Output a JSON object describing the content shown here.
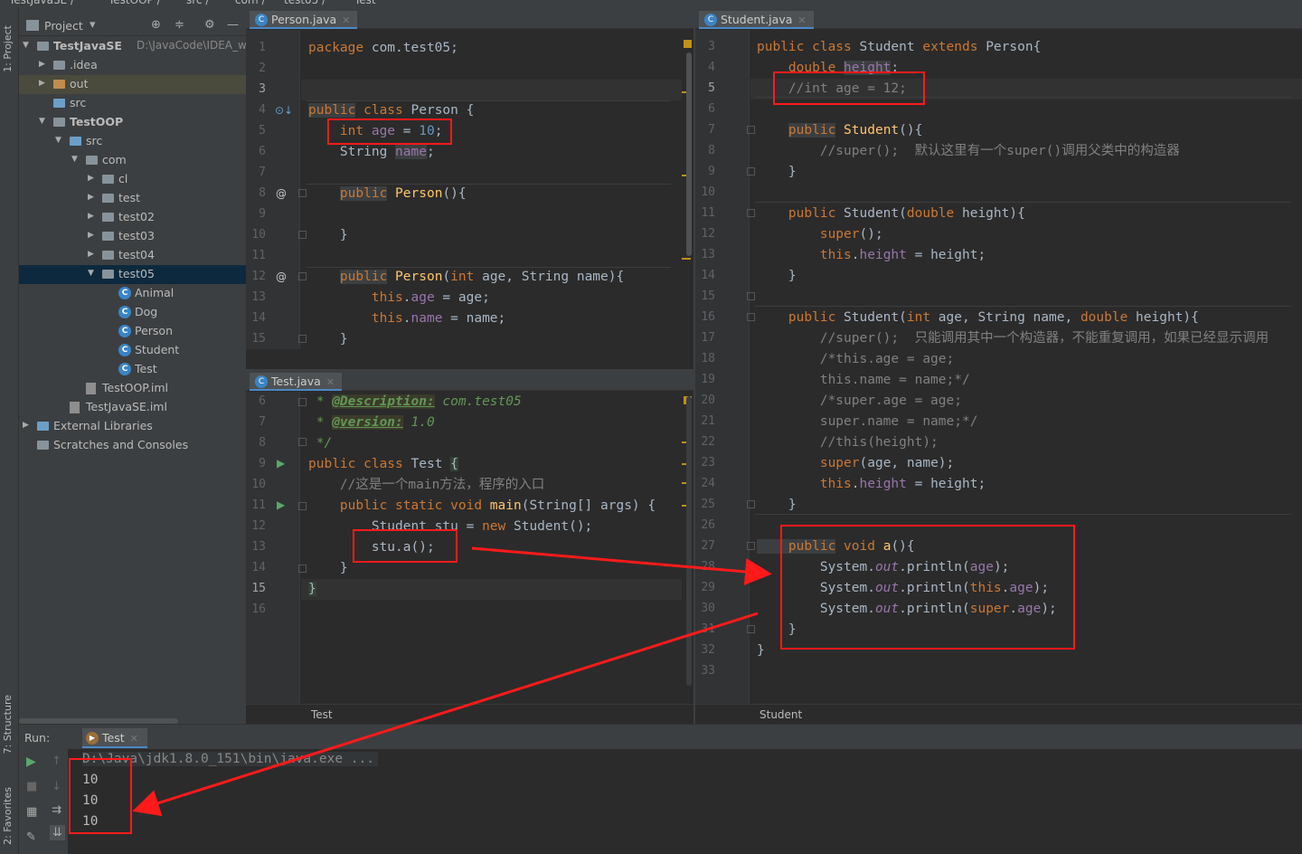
{
  "breadcrumb": [
    "TestJavaSE",
    "TestOOP",
    "src",
    "com",
    "test05",
    "Test"
  ],
  "side_tabs": {
    "project": "1: Project",
    "structure": "7: Structure",
    "favorites": "2: Favorites"
  },
  "project_panel": {
    "title": "Project",
    "tree": [
      {
        "label": "TestJavaSE",
        "extra": "D:\\JavaCode\\IDEA_work",
        "depth": 0,
        "arrow": "▼",
        "icon": "module",
        "bold": true
      },
      {
        "label": ".idea",
        "depth": 1,
        "arrow": "▶",
        "icon": "folder"
      },
      {
        "label": "out",
        "depth": 1,
        "arrow": "▶",
        "icon": "folder-orange",
        "hl": true
      },
      {
        "label": "src",
        "depth": 1,
        "arrow": "",
        "icon": "folder-blue"
      },
      {
        "label": "TestOOP",
        "depth": 1,
        "arrow": "▼",
        "icon": "module",
        "bold": true
      },
      {
        "label": "src",
        "depth": 2,
        "arrow": "▼",
        "icon": "folder-blue"
      },
      {
        "label": "com",
        "depth": 3,
        "arrow": "▼",
        "icon": "folder"
      },
      {
        "label": "cl",
        "depth": 4,
        "arrow": "▶",
        "icon": "folder"
      },
      {
        "label": "test",
        "depth": 4,
        "arrow": "▶",
        "icon": "folder"
      },
      {
        "label": "test02",
        "depth": 4,
        "arrow": "▶",
        "icon": "folder"
      },
      {
        "label": "test03",
        "depth": 4,
        "arrow": "▶",
        "icon": "folder"
      },
      {
        "label": "test04",
        "depth": 4,
        "arrow": "▶",
        "icon": "folder"
      },
      {
        "label": "test05",
        "depth": 4,
        "arrow": "▼",
        "icon": "folder",
        "selected": true
      },
      {
        "label": "Animal",
        "depth": 5,
        "arrow": "",
        "icon": "class"
      },
      {
        "label": "Dog",
        "depth": 5,
        "arrow": "",
        "icon": "class"
      },
      {
        "label": "Person",
        "depth": 5,
        "arrow": "",
        "icon": "class"
      },
      {
        "label": "Student",
        "depth": 5,
        "arrow": "",
        "icon": "class"
      },
      {
        "label": "Test",
        "depth": 5,
        "arrow": "",
        "icon": "class"
      },
      {
        "label": "TestOOP.iml",
        "depth": 3,
        "arrow": "",
        "icon": "iml"
      },
      {
        "label": "TestJavaSE.iml",
        "depth": 2,
        "arrow": "",
        "icon": "iml"
      },
      {
        "label": "External Libraries",
        "depth": 0,
        "arrow": "▶",
        "icon": "libs"
      },
      {
        "label": "Scratches and Consoles",
        "depth": 0,
        "arrow": "",
        "icon": "scratch"
      }
    ]
  },
  "person_editor": {
    "tab": "Person.java",
    "lines": [
      {
        "n": "1",
        "code": [
          [
            "kw",
            "package "
          ],
          [
            "",
            "com.test05;"
          ]
        ]
      },
      {
        "n": "2",
        "code": []
      },
      {
        "n": "3",
        "code": [],
        "cur": true
      },
      {
        "n": "4",
        "code": [
          [
            "kw unused",
            "public"
          ],
          [
            "kw",
            " class "
          ],
          [
            "",
            "Person {"
          ]
        ]
      },
      {
        "n": "5",
        "code": [
          [
            "",
            "    "
          ],
          [
            "kw",
            "int "
          ],
          [
            "fl",
            "age"
          ],
          [
            "",
            " = "
          ],
          [
            "num",
            "10"
          ],
          [
            "",
            ";"
          ]
        ]
      },
      {
        "n": "6",
        "code": [
          [
            "",
            "    String "
          ],
          [
            "fl unused",
            "name"
          ],
          [
            "",
            ";"
          ]
        ]
      },
      {
        "n": "7",
        "code": []
      },
      {
        "n": "8",
        "code": [
          [
            "",
            "    "
          ],
          [
            "kw unused",
            "public"
          ],
          [
            "",
            " "
          ],
          [
            "me",
            "Person"
          ],
          [
            "",
            "(){"
          ]
        ]
      },
      {
        "n": "9",
        "code": []
      },
      {
        "n": "10",
        "code": [
          [
            "",
            "    }"
          ]
        ]
      },
      {
        "n": "11",
        "code": []
      },
      {
        "n": "12",
        "code": [
          [
            "",
            "    "
          ],
          [
            "kw unused",
            "public"
          ],
          [
            "",
            " "
          ],
          [
            "me",
            "Person"
          ],
          [
            "",
            "("
          ],
          [
            "kw",
            "int "
          ],
          [
            "",
            "age, String name){"
          ]
        ]
      },
      {
        "n": "13",
        "code": [
          [
            "",
            "        "
          ],
          [
            "kw",
            "this"
          ],
          [
            "",
            "."
          ],
          [
            "fl",
            "age"
          ],
          [
            "",
            " = age;"
          ]
        ]
      },
      {
        "n": "14",
        "code": [
          [
            "",
            "        "
          ],
          [
            "kw",
            "this"
          ],
          [
            "",
            "."
          ],
          [
            "fl",
            "name"
          ],
          [
            "",
            " = name;"
          ]
        ]
      },
      {
        "n": "15",
        "code": [
          [
            "",
            "    }"
          ]
        ]
      }
    ]
  },
  "test_editor": {
    "tab": "Test.java",
    "breadcrumb": "Test",
    "lines": [
      {
        "n": "6",
        "code": [
          [
            "doc",
            " * "
          ],
          [
            "tag",
            "@Description:"
          ],
          [
            "doc",
            " com.test05"
          ]
        ]
      },
      {
        "n": "7",
        "code": [
          [
            "doc",
            " * "
          ],
          [
            "tag",
            "@version:"
          ],
          [
            "doc",
            " 1.0"
          ]
        ]
      },
      {
        "n": "8",
        "code": [
          [
            "doc",
            " */"
          ]
        ]
      },
      {
        "n": "9",
        "code": [
          [
            "kw",
            "public class "
          ],
          [
            "",
            "Test "
          ],
          [
            "hlbg",
            "{"
          ]
        ]
      },
      {
        "n": "10",
        "code": [
          [
            "cm",
            "    //这是一个main方法，程序的入口"
          ]
        ]
      },
      {
        "n": "11",
        "code": [
          [
            "kw",
            "    public static void "
          ],
          [
            "me",
            "main"
          ],
          [
            "",
            "(String[] args) {"
          ]
        ]
      },
      {
        "n": "12",
        "code": [
          [
            "",
            "        Student stu = "
          ],
          [
            "kw",
            "new "
          ],
          [
            "",
            "Student();"
          ]
        ]
      },
      {
        "n": "13",
        "code": [
          [
            "",
            "        stu.a();"
          ]
        ]
      },
      {
        "n": "14",
        "code": [
          [
            "",
            "    }"
          ]
        ]
      },
      {
        "n": "15",
        "code": [
          [
            "hlbg",
            "}"
          ]
        ],
        "cur": true
      },
      {
        "n": "16",
        "code": []
      }
    ]
  },
  "student_editor": {
    "tab": "Student.java",
    "breadcrumb": "Student",
    "lines": [
      {
        "n": "3",
        "code": [
          [
            "kw",
            "public class "
          ],
          [
            "",
            "Student "
          ],
          [
            "kw",
            "extends "
          ],
          [
            "",
            "Person{"
          ]
        ]
      },
      {
        "n": "4",
        "code": [
          [
            "kw",
            "    double "
          ],
          [
            "fl unused",
            "height"
          ],
          [
            "",
            ";"
          ]
        ]
      },
      {
        "n": "5",
        "code": [
          [
            "cm",
            "    //int age = 12;"
          ]
        ],
        "cur": true
      },
      {
        "n": "6",
        "code": []
      },
      {
        "n": "7",
        "code": [
          [
            "",
            "    "
          ],
          [
            "kw unused",
            "public"
          ],
          [
            "",
            " "
          ],
          [
            "me",
            "Student"
          ],
          [
            "",
            "(){"
          ]
        ]
      },
      {
        "n": "8",
        "code": [
          [
            "cm",
            "        //super();  默认这里有一个super()调用父类中的构造器"
          ]
        ]
      },
      {
        "n": "9",
        "code": [
          [
            "",
            "    }"
          ]
        ]
      },
      {
        "n": "10",
        "code": []
      },
      {
        "n": "11",
        "code": [
          [
            "kw",
            "    public "
          ],
          [
            "",
            "Student("
          ],
          [
            "kw",
            "double "
          ],
          [
            "",
            "height){"
          ]
        ]
      },
      {
        "n": "12",
        "code": [
          [
            "kw",
            "        super"
          ],
          [
            "",
            "();"
          ]
        ]
      },
      {
        "n": "13",
        "code": [
          [
            "kw",
            "        this"
          ],
          [
            "",
            "."
          ],
          [
            "fl",
            "height"
          ],
          [
            "",
            " = height;"
          ]
        ]
      },
      {
        "n": "14",
        "code": [
          [
            "",
            "    }"
          ]
        ]
      },
      {
        "n": "15",
        "code": []
      },
      {
        "n": "16",
        "code": [
          [
            "kw",
            "    public "
          ],
          [
            "",
            "Student("
          ],
          [
            "kw",
            "int "
          ],
          [
            "",
            "age, String name, "
          ],
          [
            "kw",
            "double "
          ],
          [
            "",
            "height){"
          ]
        ]
      },
      {
        "n": "17",
        "code": [
          [
            "cm",
            "        //super();  只能调用其中一个构造器，不能重复调用，如果已经显示调用"
          ]
        ]
      },
      {
        "n": "18",
        "code": [
          [
            "cm",
            "        /*this.age = age;"
          ]
        ]
      },
      {
        "n": "19",
        "code": [
          [
            "cm",
            "        this.name = name;*/"
          ]
        ]
      },
      {
        "n": "20",
        "code": [
          [
            "cm",
            "        /*super.age = age;"
          ]
        ]
      },
      {
        "n": "21",
        "code": [
          [
            "cm",
            "        super.name = name;*/"
          ]
        ]
      },
      {
        "n": "22",
        "code": [
          [
            "cm",
            "        //this(height);"
          ]
        ]
      },
      {
        "n": "23",
        "code": [
          [
            "kw",
            "        super"
          ],
          [
            "",
            "(age, name);"
          ]
        ]
      },
      {
        "n": "24",
        "code": [
          [
            "kw",
            "        this"
          ],
          [
            "",
            "."
          ],
          [
            "fl",
            "height"
          ],
          [
            "",
            " = height;"
          ]
        ]
      },
      {
        "n": "25",
        "code": [
          [
            "",
            "    }"
          ]
        ]
      },
      {
        "n": "26",
        "code": []
      },
      {
        "n": "27",
        "code": [
          [
            "kw unused",
            "    public"
          ],
          [
            "kw",
            " void "
          ],
          [
            "me",
            "a"
          ],
          [
            "",
            "(){"
          ]
        ]
      },
      {
        "n": "28",
        "code": [
          [
            "",
            "        System."
          ],
          [
            "stat",
            "out"
          ],
          [
            "",
            ".println("
          ],
          [
            "fl",
            "age"
          ],
          [
            "",
            ");"
          ]
        ]
      },
      {
        "n": "29",
        "code": [
          [
            "",
            "        System."
          ],
          [
            "stat",
            "out"
          ],
          [
            "",
            ".println("
          ],
          [
            "kw",
            "this"
          ],
          [
            "",
            "."
          ],
          [
            "fl",
            "age"
          ],
          [
            "",
            ");"
          ]
        ]
      },
      {
        "n": "30",
        "code": [
          [
            "",
            "        System."
          ],
          [
            "stat",
            "out"
          ],
          [
            "",
            ".println("
          ],
          [
            "kw",
            "super"
          ],
          [
            "",
            "."
          ],
          [
            "fl",
            "age"
          ],
          [
            "",
            ");"
          ]
        ]
      },
      {
        "n": "31",
        "code": [
          [
            "",
            "    }"
          ]
        ]
      },
      {
        "n": "32",
        "code": [
          [
            "",
            "}"
          ]
        ]
      },
      {
        "n": "33",
        "code": []
      }
    ]
  },
  "run_panel": {
    "label": "Run:",
    "tab": "Test",
    "command": "D:\\Java\\jdk1.8.0_151\\bin\\java.exe ...",
    "output": [
      "10",
      "10",
      "10"
    ]
  },
  "colors": {
    "highlight_box": "#ff1a1a",
    "arrow": "#ff1a1a",
    "selection": "#0d293e"
  }
}
